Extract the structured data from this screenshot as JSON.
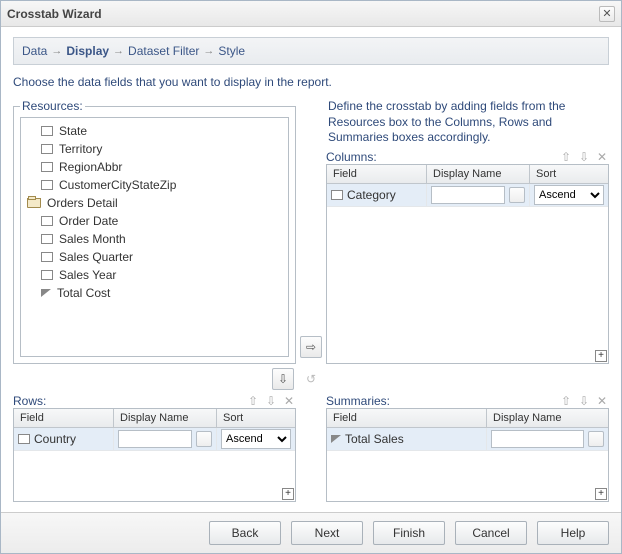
{
  "window": {
    "title": "Crosstab Wizard"
  },
  "breadcrumb": {
    "steps": [
      {
        "label": "Data"
      },
      {
        "label": "Display"
      },
      {
        "label": "Dataset Filter"
      },
      {
        "label": "Style"
      }
    ],
    "current_index": 1
  },
  "instruction": "Choose the data fields that you want to display in the report.",
  "resources": {
    "legend": "Resources:",
    "items": [
      {
        "type": "field",
        "label": "State"
      },
      {
        "type": "field",
        "label": "Territory"
      },
      {
        "type": "field",
        "label": "RegionAbbr"
      },
      {
        "type": "field",
        "label": "CustomerCityStateZip"
      }
    ],
    "folder": {
      "label": "Orders Detail"
    },
    "folder_items": [
      {
        "type": "field",
        "label": "Order Date"
      },
      {
        "type": "field",
        "label": "Sales Month"
      },
      {
        "type": "field",
        "label": "Sales Quarter"
      },
      {
        "type": "field",
        "label": "Sales Year"
      },
      {
        "type": "measure",
        "label": "Total Cost"
      }
    ]
  },
  "define_text": "Define the crosstab by adding fields from the Resources box to the Columns, Rows and Summaries boxes accordingly.",
  "columns": {
    "legend": "Columns:",
    "headers": {
      "field": "Field",
      "display": "Display Name",
      "sort": "Sort"
    },
    "rows": [
      {
        "field": "Category",
        "display": "",
        "sort": "Ascend"
      }
    ]
  },
  "rows_panel": {
    "legend": "Rows:",
    "headers": {
      "field": "Field",
      "display": "Display Name",
      "sort": "Sort"
    },
    "rows": [
      {
        "field": "Country",
        "display": "",
        "sort": "Ascend"
      }
    ]
  },
  "summaries": {
    "legend": "Summaries:",
    "headers": {
      "field": "Field",
      "display": "Display Name"
    },
    "rows": [
      {
        "field": "Total Sales",
        "display": ""
      }
    ]
  },
  "footer": {
    "back": "Back",
    "next": "Next",
    "finish": "Finish",
    "cancel": "Cancel",
    "help": "Help"
  }
}
